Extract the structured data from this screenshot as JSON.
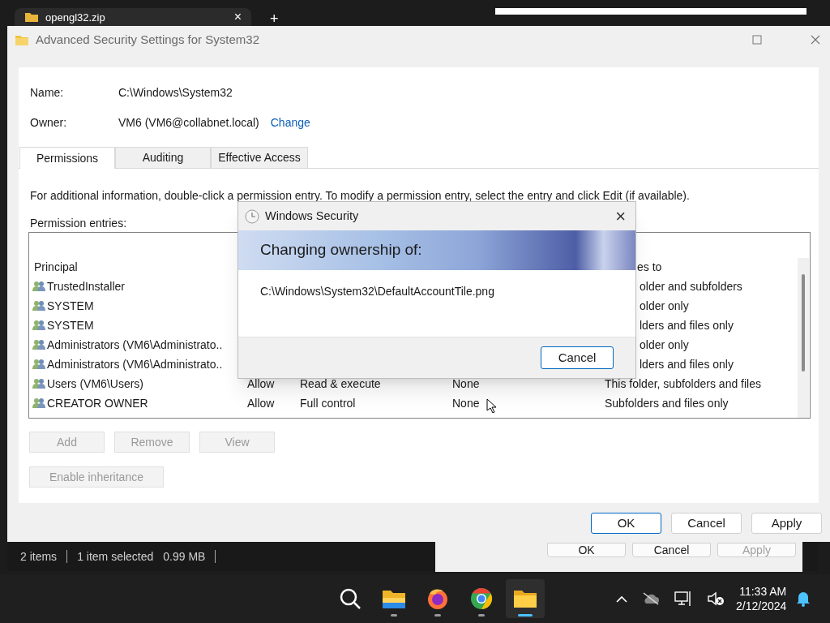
{
  "browser_tab": {
    "title": "opengl32.zip",
    "close": "×",
    "new": "+"
  },
  "window": {
    "title": "Advanced Security Settings for System32"
  },
  "name": {
    "label": "Name:",
    "value": "C:\\Windows\\System32"
  },
  "owner": {
    "label": "Owner:",
    "value": "VM6 (VM6@collabnet.local)",
    "link": "Change"
  },
  "tabs": [
    {
      "label": "Permissions",
      "selected": true
    },
    {
      "label": "Auditing",
      "selected": false
    },
    {
      "label": "Effective Access",
      "selected": false
    }
  ],
  "info": "For additional information, double-click a permission entry. To modify a permission entry, select the entry and click Edit (if available).",
  "entries_label": "Permission entries:",
  "table": {
    "columns": {
      "principal": "Principal",
      "applies_to": "es to"
    },
    "rows": [
      {
        "kind": "covered",
        "principal": "TrustedInstaller",
        "applies_to": "older and subfolders"
      },
      {
        "kind": "covered",
        "principal": "SYSTEM",
        "applies_to": "older only"
      },
      {
        "kind": "covered",
        "principal": "SYSTEM",
        "applies_to": "lders and files only"
      },
      {
        "kind": "covered",
        "principal": "Administrators (VM6\\Administrato..",
        "applies_to": "older only"
      },
      {
        "kind": "covered",
        "principal": "Administrators (VM6\\Administrato..",
        "applies_to": "lders and files only"
      },
      {
        "kind": "full",
        "principal": "Users (VM6\\Users)",
        "type": "Allow",
        "access": "Read & execute",
        "inherited": "None",
        "applies_to": "This folder, subfolders and files"
      },
      {
        "kind": "full",
        "principal": "CREATOR OWNER",
        "type": "Allow",
        "access": "Full control",
        "inherited": "None",
        "applies_to": "Subfolders and files only"
      }
    ]
  },
  "entry_buttons": [
    {
      "label": "Add",
      "disabled": true
    },
    {
      "label": "Remove",
      "disabled": true
    },
    {
      "label": "View",
      "disabled": true
    }
  ],
  "inheritance_button": {
    "label": "Enable inheritance",
    "disabled": true
  },
  "footer_buttons": [
    {
      "label": "OK",
      "default": true
    },
    {
      "label": "Cancel",
      "default": false
    },
    {
      "label": "Apply",
      "default": false
    }
  ],
  "dialog": {
    "title": "Windows Security",
    "close": "×",
    "heading": "Changing ownership of:",
    "path": "C:\\Windows\\System32\\DefaultAccountTile.png",
    "button": "Cancel"
  },
  "explorer_status": [
    "2 items",
    "1 item selected",
    "0.99 MB"
  ],
  "back_dialog_buttons": [
    {
      "label": "OK",
      "disabled": false
    },
    {
      "label": "Cancel",
      "disabled": false
    },
    {
      "label": "Apply",
      "disabled": true
    }
  ],
  "taskbar": {
    "apps": [
      {
        "kind": "search",
        "active": false,
        "running": false
      },
      {
        "kind": "explorer",
        "active": false,
        "running": true
      },
      {
        "kind": "firefox",
        "active": false,
        "running": true
      },
      {
        "kind": "chrome",
        "active": false,
        "running": true
      },
      {
        "kind": "folder",
        "active": true,
        "running": true
      }
    ],
    "time": "11:33 AM",
    "date": "2/12/2024"
  }
}
